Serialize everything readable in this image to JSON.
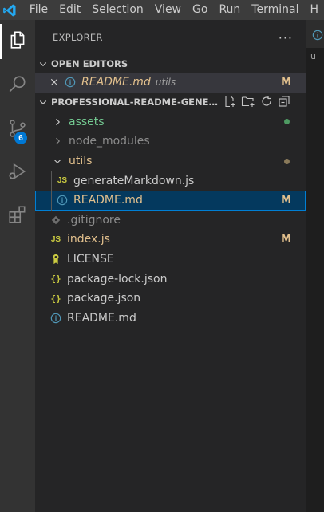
{
  "menu": [
    "File",
    "Edit",
    "Selection",
    "View",
    "Go",
    "Run",
    "Terminal",
    "H"
  ],
  "activity": {
    "source_control_badge": "6"
  },
  "explorer": {
    "title": "EXPLORER",
    "more": "···"
  },
  "open_editors": {
    "header": "OPEN EDITORS",
    "items": [
      {
        "name": "README.md",
        "folder": "utils",
        "status": "M"
      }
    ]
  },
  "project": {
    "header": "PROFESSIONAL-README-GENER...",
    "items": [
      {
        "name": "assets",
        "type": "folder",
        "state": "collapsed",
        "color": "#73c991",
        "dot": "#4e9a62"
      },
      {
        "name": "node_modules",
        "type": "folder",
        "state": "collapsed",
        "color": "#8c8c8c"
      },
      {
        "name": "utils",
        "type": "folder",
        "state": "expanded",
        "color": "#e2c08d",
        "dot": "#8a7a5a"
      },
      {
        "name": "generateMarkdown.js",
        "type": "js",
        "color": "#cccccc"
      },
      {
        "name": "README.md",
        "type": "info",
        "color": "#e2c08d",
        "status": "M",
        "selected": true
      },
      {
        "name": ".gitignore",
        "type": "git",
        "color": "#8c8c8c"
      },
      {
        "name": "index.js",
        "type": "js",
        "color": "#e2c08d",
        "status": "M"
      },
      {
        "name": "LICENSE",
        "type": "license",
        "color": "#cccccc"
      },
      {
        "name": "package-lock.json",
        "type": "json",
        "color": "#cccccc"
      },
      {
        "name": "package.json",
        "type": "json",
        "color": "#cccccc"
      },
      {
        "name": "README.md",
        "type": "info",
        "color": "#cccccc"
      }
    ]
  },
  "editor": {
    "breadcrumb_partial": "u"
  }
}
